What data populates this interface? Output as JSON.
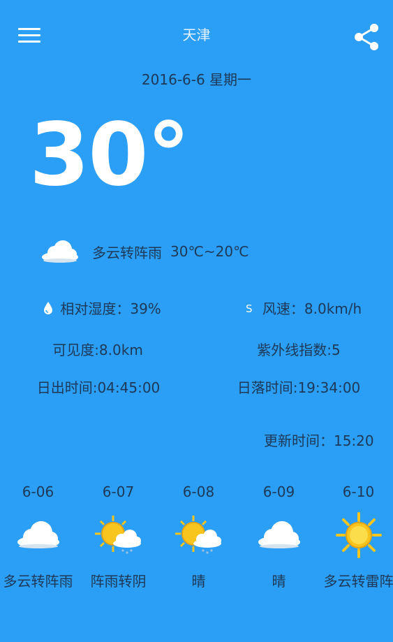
{
  "header": {
    "city": "天津",
    "menu_icon": "hamburger-menu-icon",
    "share_icon": "share-icon"
  },
  "date_line": "2016-6-6 星期一",
  "current": {
    "temperature": "30°",
    "condition_icon": "cloud-icon",
    "condition": "多云转阵雨",
    "temp_range": "30℃~20℃"
  },
  "details": {
    "humidity_icon": "water-drop-icon",
    "humidity": "相对湿度：39%",
    "wind_icon": "wind-icon",
    "wind_glyph": "S",
    "wind": "风速：8.0km/h",
    "visibility": "可见度:8.0km",
    "uv_index": "紫外线指数:5",
    "sunrise": "日出时间:04:45:00",
    "sunset": "日落时间:19:34:00"
  },
  "updated": "更新时间：15:20",
  "forecast": [
    {
      "date": "6-06",
      "icon": "cloud-icon",
      "condition": "多云转阵雨"
    },
    {
      "date": "6-07",
      "icon": "sun-cloud-rain-icon",
      "condition": "阵雨转阴"
    },
    {
      "date": "6-08",
      "icon": "sun-cloud-rain-icon",
      "condition": "晴"
    },
    {
      "date": "6-09",
      "icon": "cloud-icon",
      "condition": "晴"
    },
    {
      "date": "6-10",
      "icon": "sun-icon",
      "condition": "多云转雷阵"
    }
  ],
  "colors": {
    "background": "#2b9ef5",
    "primary_text": "#1e3857",
    "accent_white": "#ffffff",
    "sun_yellow": "#f7c51e"
  }
}
